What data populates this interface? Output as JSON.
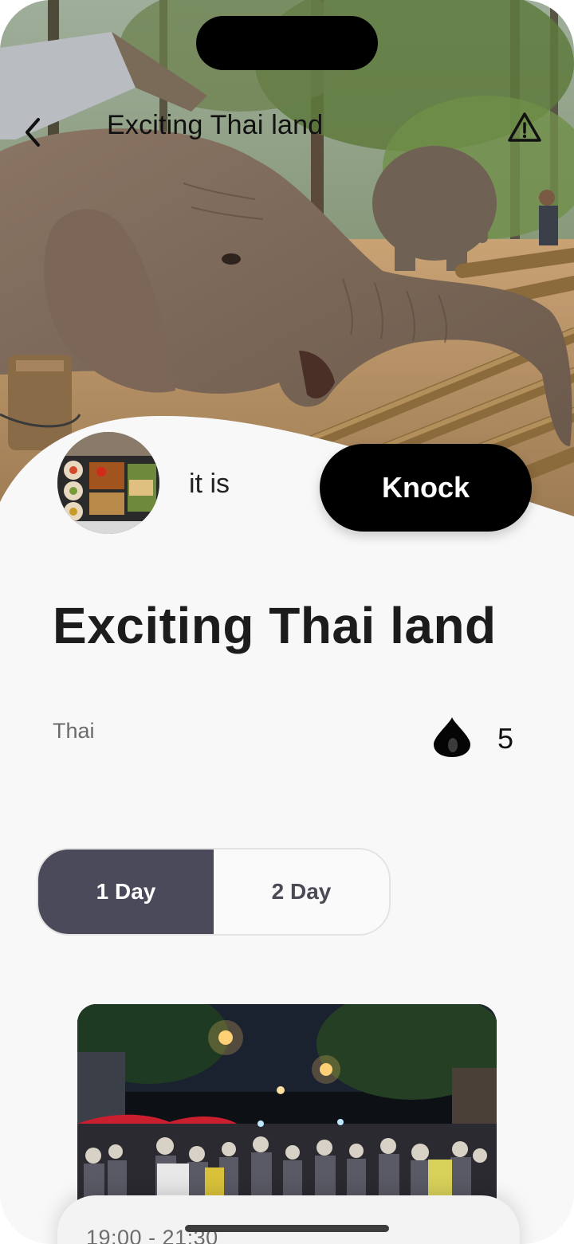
{
  "header": {
    "title": "Exciting Thai land"
  },
  "author": {
    "name": "it is"
  },
  "actions": {
    "knock_label": "Knock"
  },
  "post": {
    "title": "Exciting Thai land",
    "category": "Thai",
    "drop_count": "5"
  },
  "day_tabs": {
    "items": [
      {
        "label": "1 Day",
        "selected": true
      },
      {
        "label": "2 Day",
        "selected": false
      }
    ]
  },
  "schedule": {
    "time": "19:00 - 21:30"
  },
  "colors": {
    "segment_active": "#4b4a5a",
    "knock_button": "#000000",
    "background": "#f8f8f8"
  },
  "icons": {
    "back": "chevron-left-icon",
    "report": "warning-triangle-icon",
    "drop": "drop-icon"
  }
}
